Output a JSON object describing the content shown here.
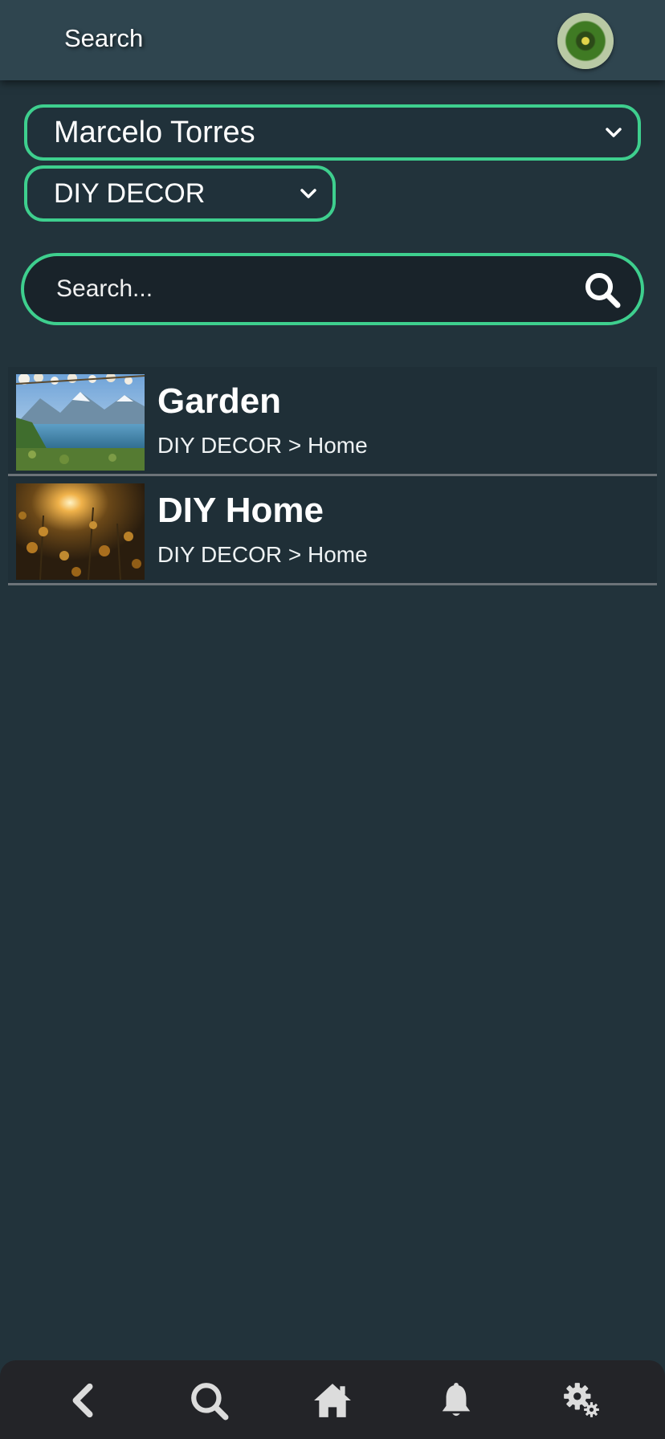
{
  "header": {
    "title": "Search",
    "avatar_icon": "kiwi-profile-avatar"
  },
  "filters": {
    "user_select": {
      "value": "Marcelo Torres"
    },
    "category_select": {
      "value": "DIY DECOR"
    }
  },
  "search": {
    "placeholder": "Search...",
    "value": "",
    "icon": "search-icon"
  },
  "results": [
    {
      "title": "Garden",
      "path": "DIY DECOR > Home",
      "thumbnail": "lake-mountain-photo"
    },
    {
      "title": "DIY Home",
      "path": "DIY DECOR > Home",
      "thumbnail": "sunflowers-sunset-photo"
    }
  ],
  "bottom_nav": {
    "items": [
      "back-icon",
      "search-icon",
      "home-icon",
      "bell-icon",
      "settings-gears-icon"
    ]
  },
  "colors": {
    "accent": "#3ecf8e",
    "background": "#22333b",
    "header": "#2f454f",
    "nav_bar": "#232428"
  }
}
